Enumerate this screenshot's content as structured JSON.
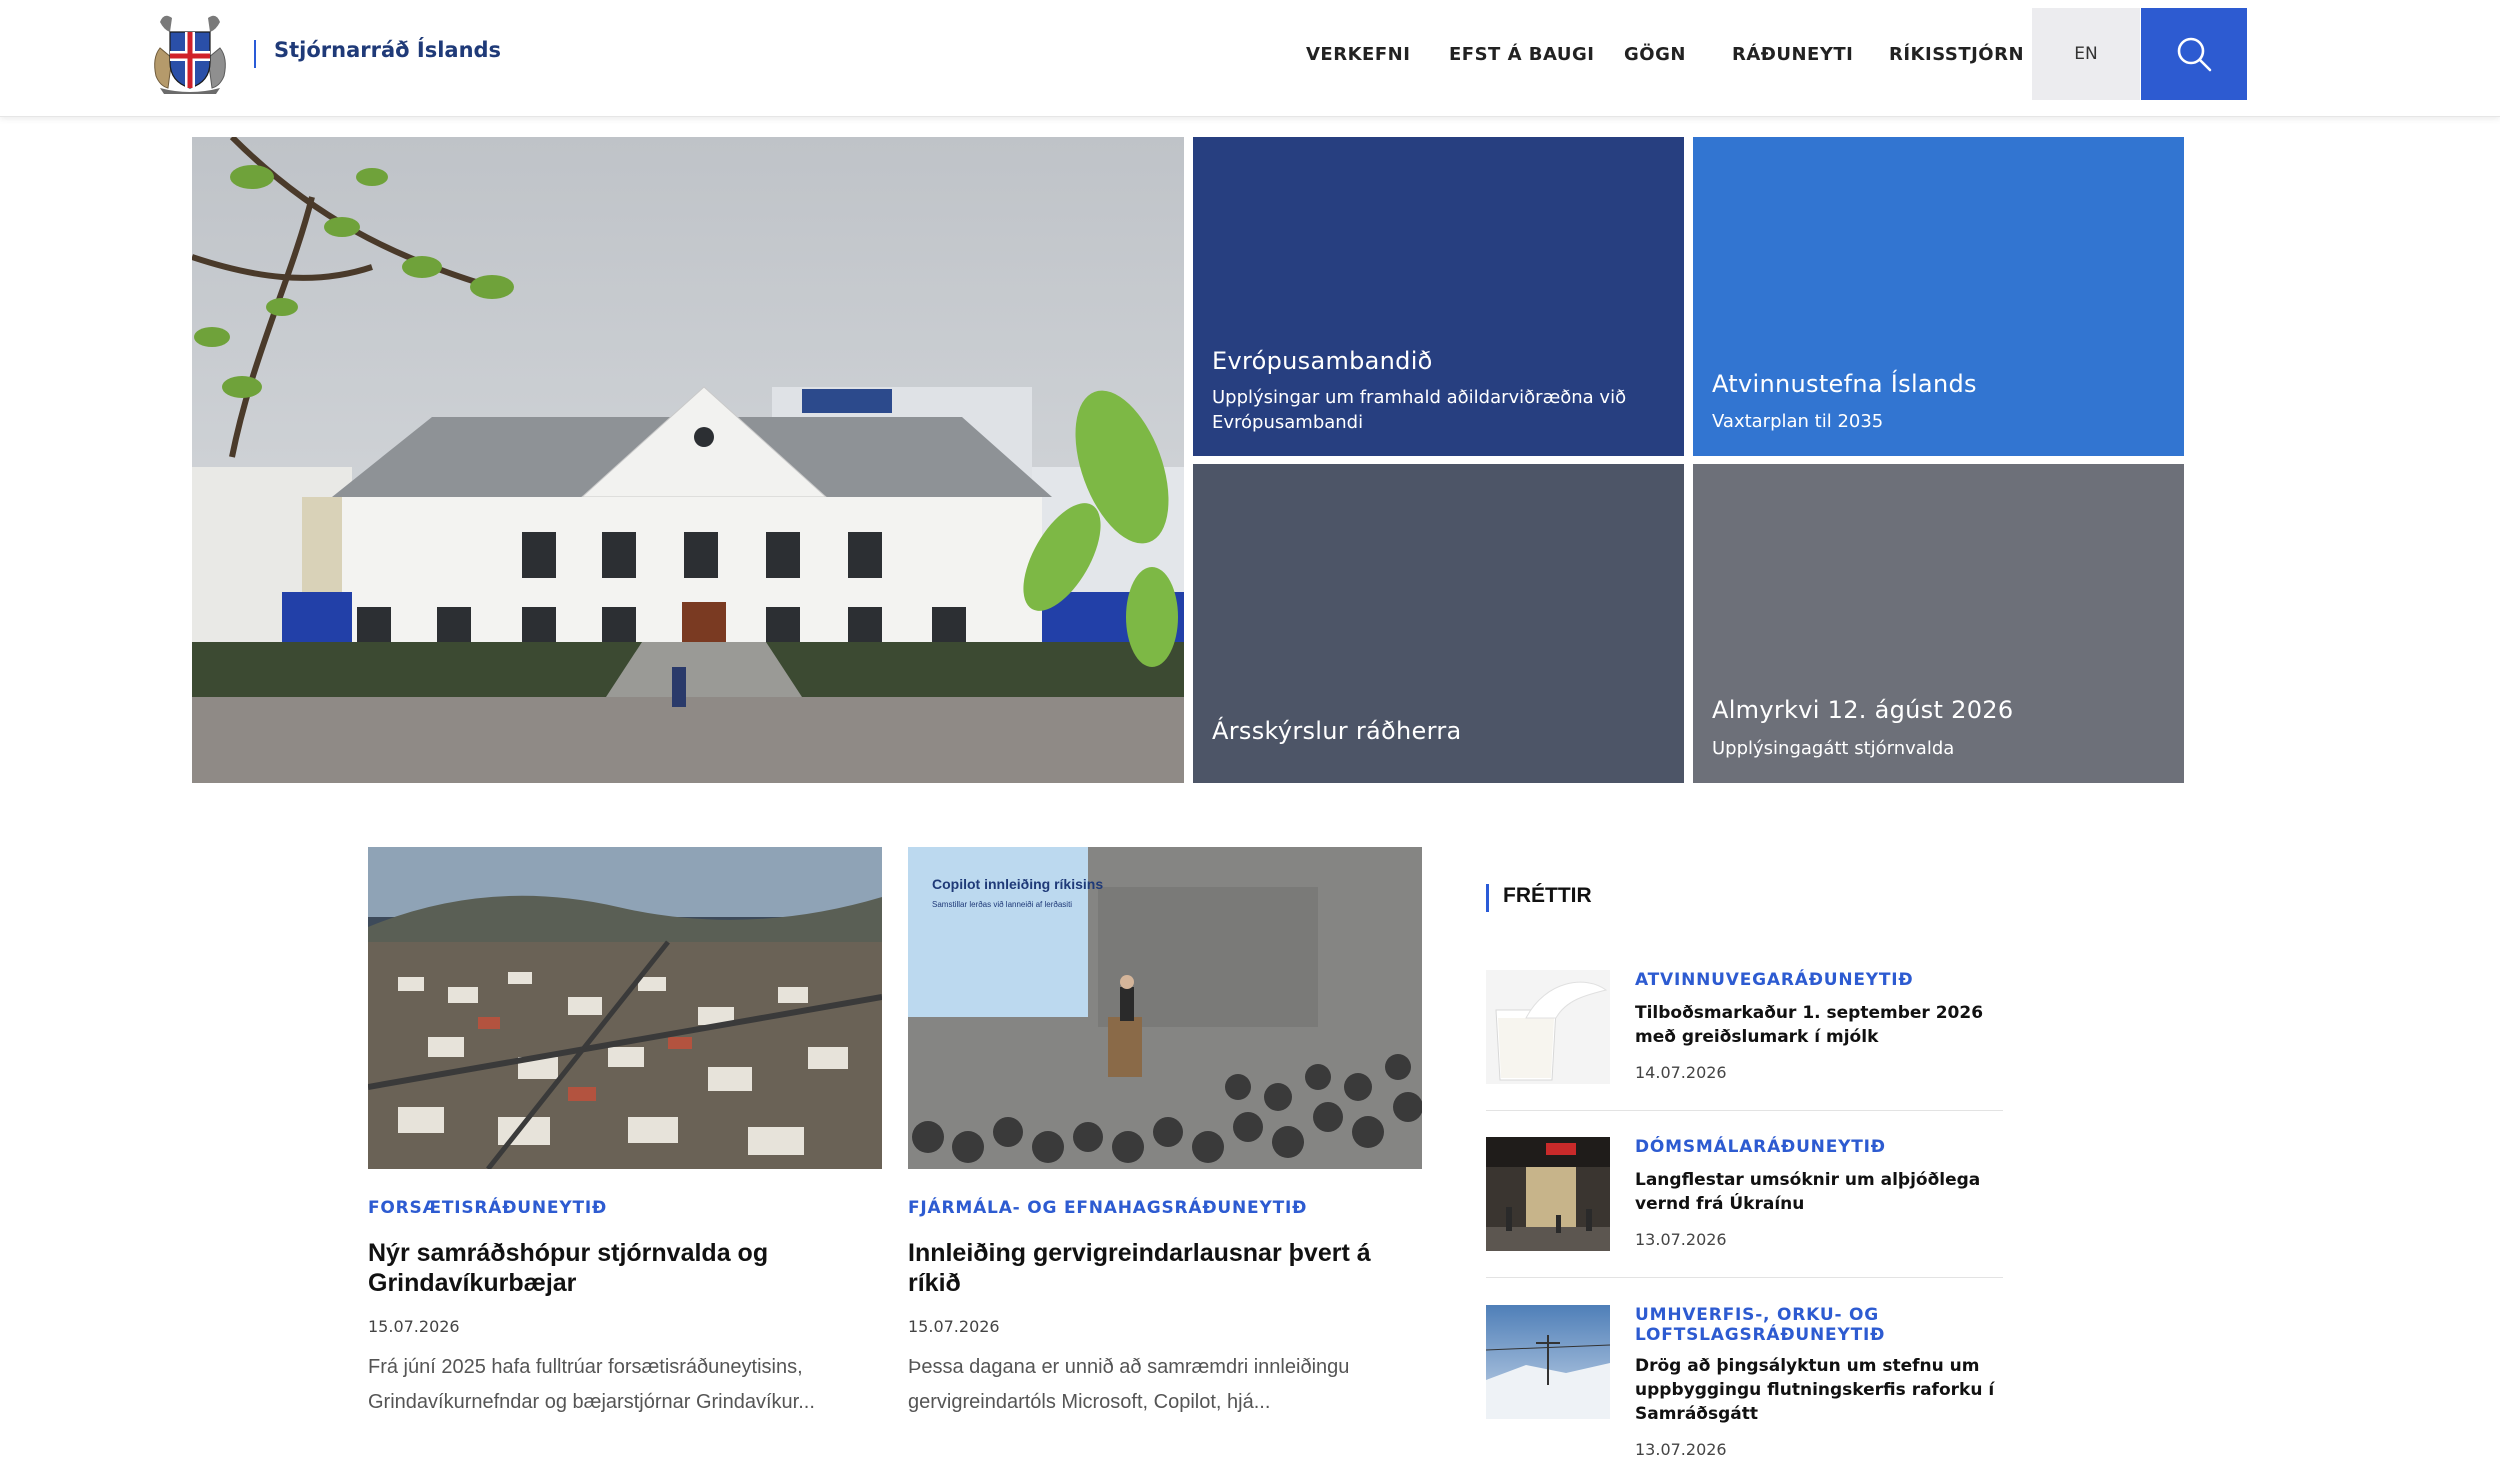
{
  "header": {
    "site_name": "Stjórnarráð Íslands",
    "nav": [
      "VERKEFNI",
      "EFST Á BAUGI",
      "GÖGN",
      "RÁÐUNEYTI",
      "RÍKISSTJÓRN"
    ],
    "lang_label": "EN",
    "search_icon": "search-icon",
    "accent_color": "#2d5bd1"
  },
  "hero": {
    "tiles": [
      {
        "title": "Evrópusambandið",
        "subtitle": "Upplýsingar um framhald aðildarviðræðna við Evrópusambandi",
        "color": "#273f80"
      },
      {
        "title": "Atvinnustefna Íslands",
        "subtitle": "Vaxtarplan til 2035",
        "color": "#3275d1"
      },
      {
        "title": "Ársskýrslur ráðherra",
        "subtitle": "",
        "color": "#4d5567"
      },
      {
        "title": "Almyrkvi 12. ágúst 2026",
        "subtitle": "Upplýsingagátt stjórnvalda",
        "color": "#6d7079"
      }
    ]
  },
  "cards": [
    {
      "category": "FORSÆTISRÁÐUNEYTIÐ",
      "title": "Nýr samráðshópur stjórnvalda og Grindavíkurbæjar",
      "date": "15.07.2026",
      "excerpt": "Frá júní 2025 hafa fulltrúar forsætisráðuneytisins, Grindavíkurnefndar og bæjarstjórnar Grindavíkur..."
    },
    {
      "category": "FJÁRMÁLA- OG EFNAHAGSRÁÐUNEYTIÐ",
      "title": "Innleiðing gervigreindarlausnar þvert á ríkið",
      "date": "15.07.2026",
      "excerpt": "Þessa dagana er unnið að samræmdri innleiðingu gervigreindartóls Microsoft, Copilot, hjá...",
      "slide_title": "Copilot innleiðing ríkisins",
      "slide_sub": "Samstillar lerðas við lanneiði af lerðasiti"
    }
  ],
  "frettir": {
    "heading": "FRÉTTIR",
    "items": [
      {
        "category": "ATVINNUVEGARÁÐUNEYTIÐ",
        "title": "Tilboðsmarkaður 1. september 2026 með greiðslumark í mjólk",
        "date": "14.07.2026"
      },
      {
        "category": "DÓMSMÁLARÁÐUNEYTIÐ",
        "title": "Langflestar umsóknir um alþjóðlega vernd frá Úkraínu",
        "date": "13.07.2026"
      },
      {
        "category": "UMHVERFIS-, ORKU- OG LOFTSLAGSRÁÐUNEYTIÐ",
        "title": "Drög að þingsályktun um stefnu um uppbyggingu flutningskerfis raforku í Samráðsgátt",
        "date": "13.07.2026"
      }
    ]
  }
}
